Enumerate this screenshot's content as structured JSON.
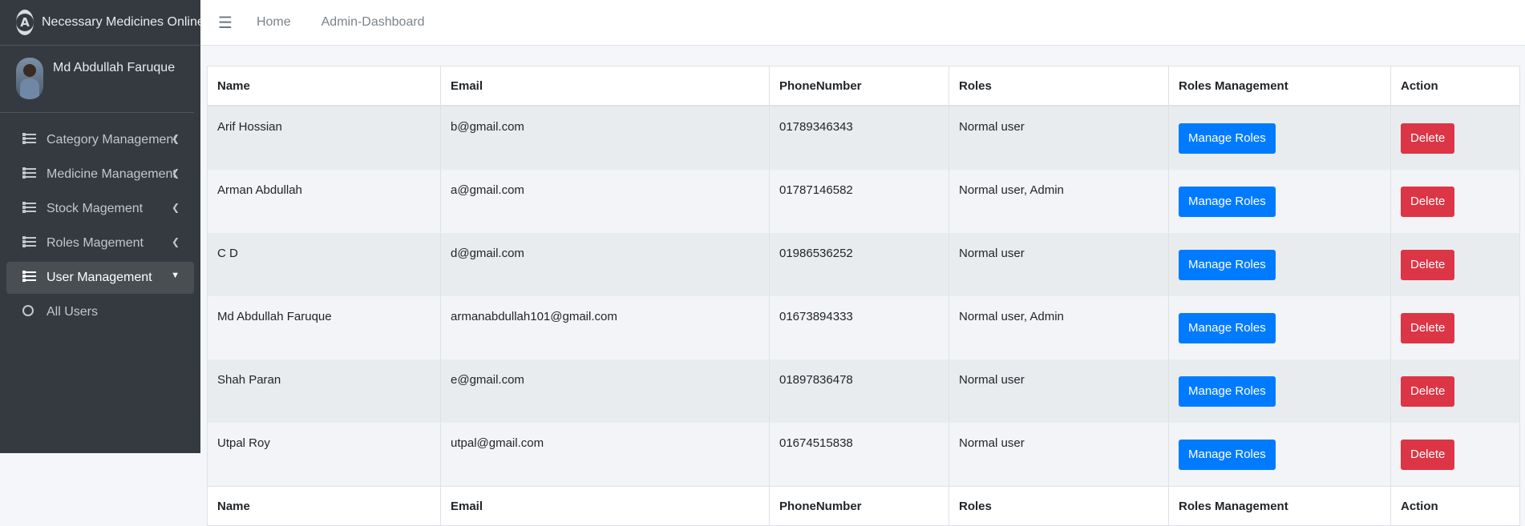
{
  "brand": {
    "name": "Necessary Medicines Online",
    "logo_letter": "A"
  },
  "user": {
    "name": "Md Abdullah Faruque"
  },
  "sidebar": {
    "items": [
      {
        "label": "Category Management",
        "icon": "list-icon",
        "expanded": false
      },
      {
        "label": "Medicine Management",
        "icon": "list-icon",
        "expanded": false
      },
      {
        "label": "Stock Magement",
        "icon": "list-icon",
        "expanded": false
      },
      {
        "label": "Roles Magement",
        "icon": "list-icon",
        "expanded": false
      },
      {
        "label": "User Management",
        "icon": "list-icon",
        "expanded": true,
        "active": true
      },
      {
        "label": "All Users",
        "icon": "circle-icon"
      }
    ]
  },
  "topbar": {
    "links": [
      "Home",
      "Admin-Dashboard"
    ],
    "menu_icon": "hamburger-icon"
  },
  "table": {
    "headers": [
      "Name",
      "Email",
      "PhoneNumber",
      "Roles",
      "Roles Management",
      "Action"
    ],
    "rows": [
      {
        "name": "Arif Hossian",
        "email": "b@gmail.com",
        "phone": "01789346343",
        "roles": "Normal user"
      },
      {
        "name": "Arman Abdullah",
        "email": "a@gmail.com",
        "phone": "01787146582",
        "roles": "Normal user, Admin"
      },
      {
        "name": "C D",
        "email": "d@gmail.com",
        "phone": "01986536252",
        "roles": "Normal user"
      },
      {
        "name": "Md Abdullah Faruque",
        "email": "armanabdullah101@gmail.com",
        "phone": "01673894333",
        "roles": "Normal user, Admin"
      },
      {
        "name": "Shah Paran",
        "email": "e@gmail.com",
        "phone": "01897836478",
        "roles": "Normal user"
      },
      {
        "name": "Utpal Roy",
        "email": "utpal@gmail.com",
        "phone": "01674515838",
        "roles": "Normal user"
      }
    ],
    "manage_label": "Manage Roles",
    "delete_label": "Delete"
  },
  "colors": {
    "sidebar": "#343a40",
    "primary": "#007bff",
    "danger": "#dc3545"
  }
}
